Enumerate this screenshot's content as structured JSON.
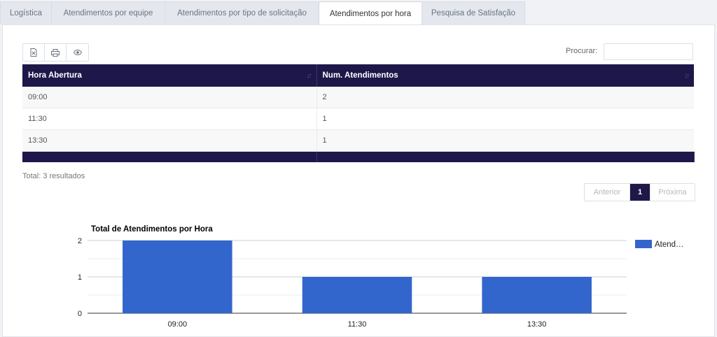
{
  "tabs": [
    {
      "label": "Logística",
      "active": false
    },
    {
      "label": "Atendimentos por equipe",
      "active": false
    },
    {
      "label": "Atendimentos por tipo de solicitação",
      "active": false
    },
    {
      "label": "Atendimentos por hora",
      "active": true
    },
    {
      "label": "Pesquisa de Satisfação",
      "active": false
    }
  ],
  "toolbar": {
    "buttons": [
      {
        "icon": "excel-icon"
      },
      {
        "icon": "print-icon"
      },
      {
        "icon": "eye-icon"
      }
    ]
  },
  "search": {
    "label": "Procurar:",
    "value": "",
    "placeholder": ""
  },
  "table": {
    "headers": [
      "Hora Abertura",
      "Num. Atendimentos"
    ],
    "rows": [
      [
        "09:00",
        "2"
      ],
      [
        "11:30",
        "1"
      ],
      [
        "13:30",
        "1"
      ]
    ]
  },
  "summary": {
    "total": "Total: 3 resultados"
  },
  "pagination": {
    "prev": "Anterior",
    "current": "1",
    "next": "Próxima"
  },
  "colors": {
    "header_bg": "#1d1849",
    "bar": "#3366cc"
  },
  "chart_data": {
    "type": "bar",
    "title": "Total de Atendimentos por Hora",
    "categories": [
      "09:00",
      "11:30",
      "13:30"
    ],
    "series": [
      {
        "name": "Atend…",
        "values": [
          2,
          1,
          1
        ]
      }
    ],
    "ylim": [
      0,
      2
    ],
    "yticks": [
      0,
      1,
      2
    ],
    "legend": "right",
    "grid": true
  }
}
